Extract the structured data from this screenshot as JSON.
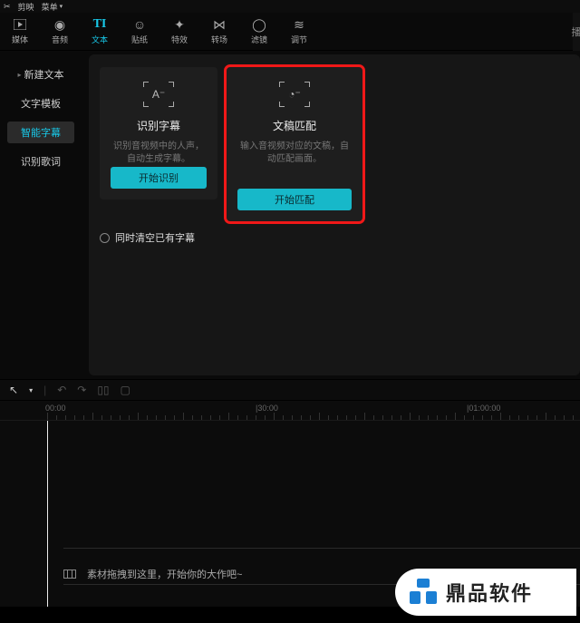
{
  "titlebar": {
    "app": "剪映",
    "menu": "菜单"
  },
  "toolbar": [
    {
      "label": "媒体",
      "glyph": "▸"
    },
    {
      "label": "音频",
      "glyph": "◔"
    },
    {
      "label": "文本",
      "glyph": "TI",
      "active": true
    },
    {
      "label": "贴纸",
      "glyph": "☺"
    },
    {
      "label": "特效",
      "glyph": "✦"
    },
    {
      "label": "转场",
      "glyph": "⇆"
    },
    {
      "label": "滤镜",
      "glyph": "◯"
    },
    {
      "label": "调节",
      "glyph": "≈"
    }
  ],
  "sidebar": {
    "items": [
      {
        "label": "新建文本",
        "caret": true
      },
      {
        "label": "文字模板"
      },
      {
        "label": "智能字幕",
        "active": true
      },
      {
        "label": "识别歌词"
      }
    ]
  },
  "cards": [
    {
      "icon": "A⁻",
      "title": "识别字幕",
      "desc": "识别音视频中的人声，自动生成字幕。",
      "button": "开始识别"
    },
    {
      "icon": "◔⁻",
      "title": "文稿匹配",
      "desc": "输入音视频对应的文稿，自动匹配画面。",
      "button": "开始匹配",
      "highlighted": true
    }
  ],
  "checkbox": {
    "label": "同时清空已有字幕"
  },
  "ruler": {
    "marks": [
      "00:00",
      "|30:00",
      "|01:00:00"
    ]
  },
  "timeline": {
    "hint": "素材拖拽到这里，开始你的大作吧~"
  },
  "right_tab": "播",
  "watermark": {
    "text": "鼎品软件"
  }
}
